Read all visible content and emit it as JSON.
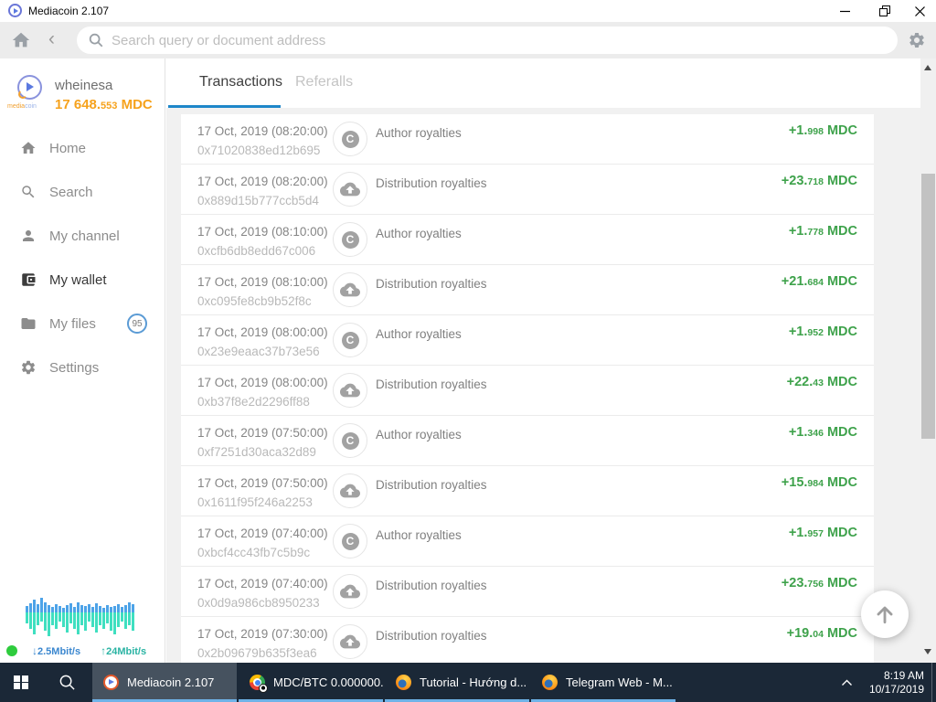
{
  "window": {
    "title": "Mediacoin 2.107"
  },
  "toolbar": {
    "search_placeholder": "Search query or document address",
    "back_glyph": "‹"
  },
  "sidebar": {
    "user": {
      "name": "wheinesa",
      "balance_whole": "17 648.",
      "balance_frac": "553",
      "balance_suffix": " MDC",
      "logo_media": "media",
      "logo_coin": "coin"
    },
    "menu": [
      {
        "label": "Home"
      },
      {
        "label": "Search"
      },
      {
        "label": "My channel"
      },
      {
        "label": "My wallet",
        "active": true
      },
      {
        "label": "My files",
        "badge": "95"
      },
      {
        "label": "Settings"
      }
    ],
    "network": {
      "download_icon": "↓",
      "download": "2.5Mbit/s",
      "upload_icon": "↑",
      "upload": "24Mbit/s",
      "bars": [
        [
          7,
          12
        ],
        [
          10,
          18
        ],
        [
          14,
          24
        ],
        [
          9,
          14
        ],
        [
          16,
          10
        ],
        [
          11,
          20
        ],
        [
          8,
          26
        ],
        [
          6,
          14
        ],
        [
          9,
          18
        ],
        [
          7,
          10
        ],
        [
          5,
          16
        ],
        [
          8,
          22
        ],
        [
          10,
          12
        ],
        [
          6,
          18
        ],
        [
          11,
          24
        ],
        [
          8,
          14
        ],
        [
          7,
          20
        ],
        [
          9,
          10
        ],
        [
          6,
          16
        ],
        [
          10,
          22
        ],
        [
          7,
          14
        ],
        [
          5,
          18
        ],
        [
          8,
          12
        ],
        [
          6,
          20
        ],
        [
          7,
          24
        ],
        [
          9,
          16
        ],
        [
          6,
          10
        ],
        [
          8,
          18
        ],
        [
          11,
          14
        ],
        [
          9,
          20
        ]
      ]
    }
  },
  "main": {
    "tabs": [
      {
        "label": "Transactions",
        "active": true
      },
      {
        "label": "Referalls",
        "active": false
      }
    ],
    "author_icon_glyph": "C",
    "amount_suffix": " MDC",
    "transactions": [
      {
        "date": "17 Oct, 2019 (08:20:00)",
        "hash": "0x71020838ed12b695",
        "type": "Author royalties",
        "icon": "author",
        "amount_whole": "+1.",
        "amount_frac": "998"
      },
      {
        "date": "17 Oct, 2019 (08:20:00)",
        "hash": "0x889d15b777ccb5d4",
        "type": "Distribution royalties",
        "icon": "distribution",
        "amount_whole": "+23.",
        "amount_frac": "718"
      },
      {
        "date": "17 Oct, 2019 (08:10:00)",
        "hash": "0xcfb6db8edd67c006",
        "type": "Author royalties",
        "icon": "author",
        "amount_whole": "+1.",
        "amount_frac": "778"
      },
      {
        "date": "17 Oct, 2019 (08:10:00)",
        "hash": "0xc095fe8cb9b52f8c",
        "type": "Distribution royalties",
        "icon": "distribution",
        "amount_whole": "+21.",
        "amount_frac": "684"
      },
      {
        "date": "17 Oct, 2019 (08:00:00)",
        "hash": "0x23e9eaac37b73e56",
        "type": "Author royalties",
        "icon": "author",
        "amount_whole": "+1.",
        "amount_frac": "952"
      },
      {
        "date": "17 Oct, 2019 (08:00:00)",
        "hash": "0xb37f8e2d2296ff88",
        "type": "Distribution royalties",
        "icon": "distribution",
        "amount_whole": "+22.",
        "amount_frac": "43"
      },
      {
        "date": "17 Oct, 2019 (07:50:00)",
        "hash": "0xf7251d30aca32d89",
        "type": "Author royalties",
        "icon": "author",
        "amount_whole": "+1.",
        "amount_frac": "346"
      },
      {
        "date": "17 Oct, 2019 (07:50:00)",
        "hash": "0x1611f95f246a2253",
        "type": "Distribution royalties",
        "icon": "distribution",
        "amount_whole": "+15.",
        "amount_frac": "984"
      },
      {
        "date": "17 Oct, 2019 (07:40:00)",
        "hash": "0xbcf4cc43fb7c5b9c",
        "type": "Author royalties",
        "icon": "author",
        "amount_whole": "+1.",
        "amount_frac": "957"
      },
      {
        "date": "17 Oct, 2019 (07:40:00)",
        "hash": "0x0d9a986cb8950233",
        "type": "Distribution royalties",
        "icon": "distribution",
        "amount_whole": "+23.",
        "amount_frac": "756"
      },
      {
        "date": "17 Oct, 2019 (07:30:00)",
        "hash": "0x2b09679b635f3ea6",
        "type": "Distribution royalties",
        "icon": "distribution",
        "amount_whole": "+19.",
        "amount_frac": "04"
      }
    ]
  },
  "taskbar": {
    "items": [
      {
        "label": "Mediacoin 2.107",
        "icon": "mediacoin",
        "active": true
      },
      {
        "label": "MDC/BTC 0.000000...",
        "icon": "chrome",
        "active": false
      },
      {
        "label": "Tutorial - Hướng d...",
        "icon": "firefox",
        "active": false
      },
      {
        "label": "Telegram Web - M...",
        "icon": "firefox",
        "active": false
      }
    ],
    "tray": {
      "time": "8:19 AM",
      "date": "10/17/2019"
    }
  },
  "colors": {
    "accent_blue": "#1e87c9",
    "amount_green": "#3ea24b",
    "balance_orange": "#f6a21c",
    "taskbar_bg": "#1b2837",
    "task_underline": "#6fb3e8"
  }
}
